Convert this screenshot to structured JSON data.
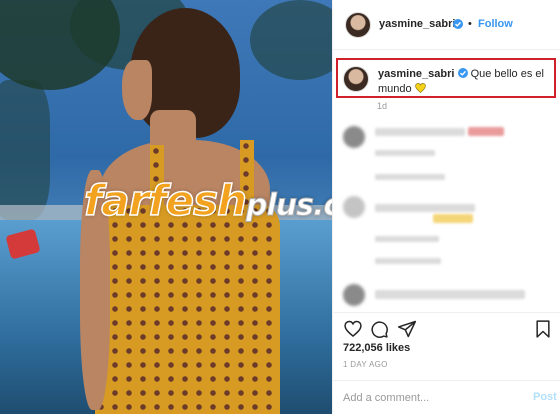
{
  "post": {
    "username": "yasmine_sabri",
    "follow_label": "Follow",
    "dot": "•",
    "caption_username": "yasmine_sabri",
    "caption_text": "Que bello es el mundo",
    "caption_time": "1d",
    "likes": "722,056 likes",
    "date": "1 DAY AGO"
  },
  "watermark": {
    "main": "farfesh",
    "suffix": "plus.com"
  },
  "comment_box": {
    "placeholder": "Add a comment...",
    "post_label": "Post"
  },
  "colors": {
    "accent": "#3897f0",
    "highlight_border": "#d0202a",
    "watermark": "#f2a21e"
  },
  "icons": [
    "heart-icon",
    "comment-icon",
    "share-icon",
    "bookmark-icon",
    "verified-icon",
    "yellow-heart-emoji"
  ]
}
